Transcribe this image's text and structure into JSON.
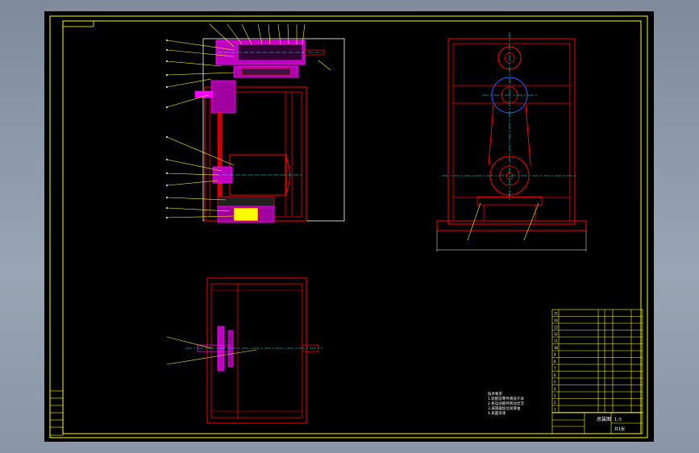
{
  "title_block_notes": {
    "lines": [
      "技术要求",
      "1.装配前零件清洗干净",
      "2.各运动部件转动灵活",
      "3.减速器加注润滑油",
      "4.表面涂漆"
    ]
  },
  "parts_list": {
    "rows": [
      "15",
      "14",
      "13",
      "12",
      "11",
      "10",
      "9",
      "8",
      "7",
      "6",
      "5",
      "4",
      "3",
      "2",
      "1"
    ]
  },
  "title_block": {
    "drawing_name": "总装图",
    "scale": "1:5",
    "sheet": "共1张"
  },
  "colors": {
    "sheet": "#000000",
    "frame": "#ffff00",
    "part": "#ff0000",
    "section": "#ff00ff",
    "center": "#00ffff",
    "leader": "#ffff00",
    "dims": "#ffffff"
  }
}
